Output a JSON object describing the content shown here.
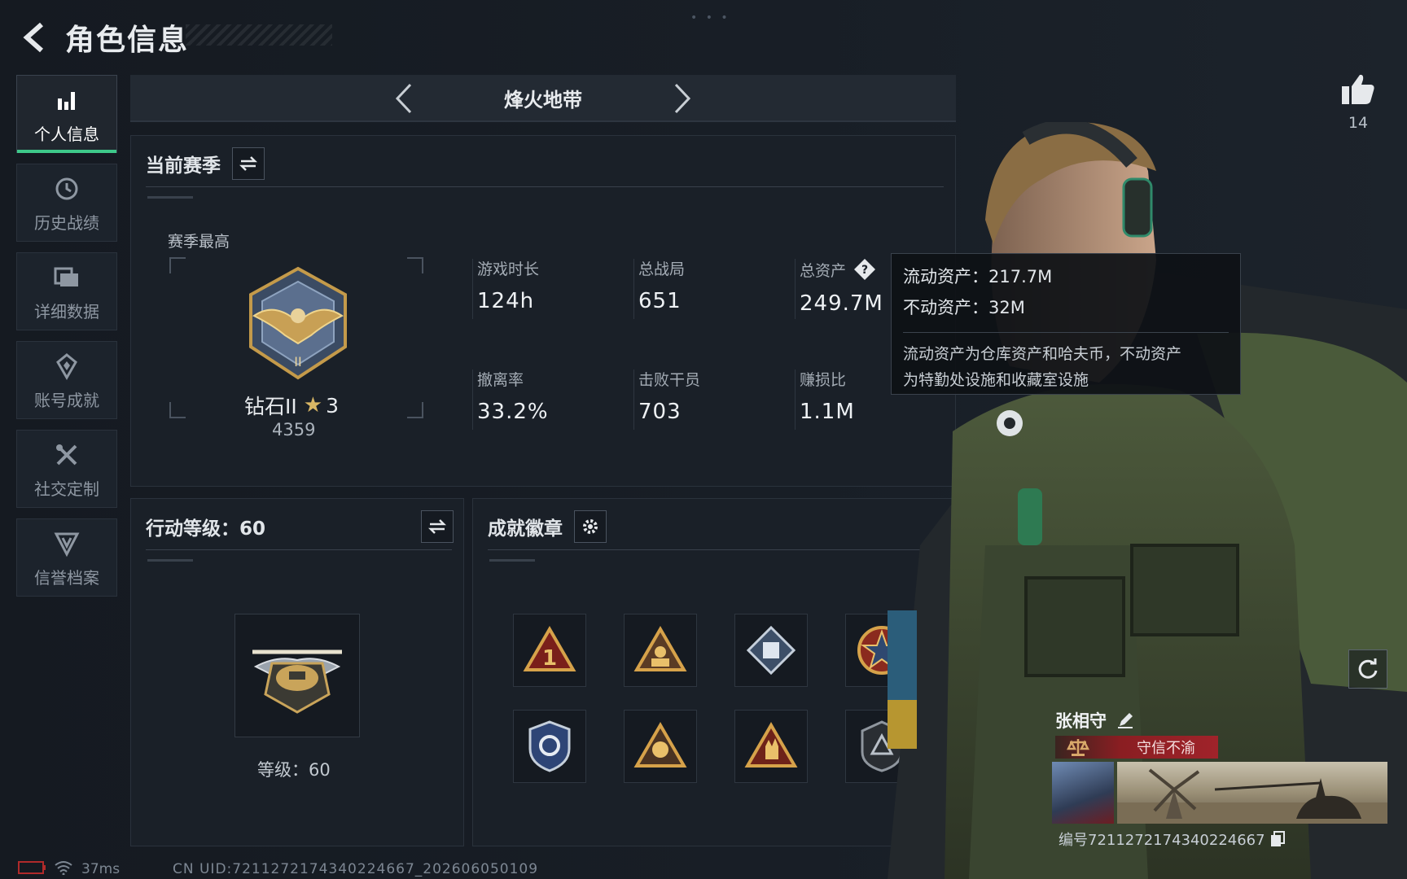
{
  "header": {
    "title": "角色信息"
  },
  "nav": {
    "items": [
      {
        "label": "个人信息",
        "icon": "bar-chart-icon"
      },
      {
        "label": "历史战绩",
        "icon": "history-icon"
      },
      {
        "label": "详细数据",
        "icon": "folder-icon"
      },
      {
        "label": "账号成就",
        "icon": "achievement-icon"
      },
      {
        "label": "社交定制",
        "icon": "tools-icon"
      },
      {
        "label": "信誉档案",
        "icon": "credit-shield-icon"
      }
    ]
  },
  "mode": {
    "title": "烽火地带"
  },
  "season": {
    "title": "当前赛季",
    "best_label": "赛季最高",
    "rank_name": "钻石II",
    "rank_stars": "3",
    "rank_score": "4359",
    "stats": [
      {
        "label": "游戏时长",
        "value": "124h"
      },
      {
        "label": "总战局",
        "value": "651"
      },
      {
        "label": "总资产",
        "value": "249.7M"
      },
      {
        "label": "撤离率",
        "value": "33.2%"
      },
      {
        "label": "击败干员",
        "value": "703"
      },
      {
        "label": "赚损比",
        "value": "1.1M"
      }
    ]
  },
  "tooltip": {
    "liquid": "流动资产：217.7M",
    "fixed": "不动资产：32M",
    "desc1": "流动资产为仓库资产和哈夫币，不动资产",
    "desc2": "为特勤处设施和收藏室设施"
  },
  "action_level": {
    "title": "行动等级：60",
    "level_text": "等级：60"
  },
  "badges": {
    "title": "成就徽章"
  },
  "like": {
    "count": "14"
  },
  "player": {
    "name": "张相守",
    "credit": "守信不渝",
    "id": "编号72112721743402246​67"
  },
  "footer": {
    "ping": "37ms",
    "uid": "CN UID:72112721743402246​67_202606050109"
  },
  "colors": {
    "accent": "#3ec98a",
    "credit_red": "#a0232a",
    "panel": "#1a2028"
  }
}
